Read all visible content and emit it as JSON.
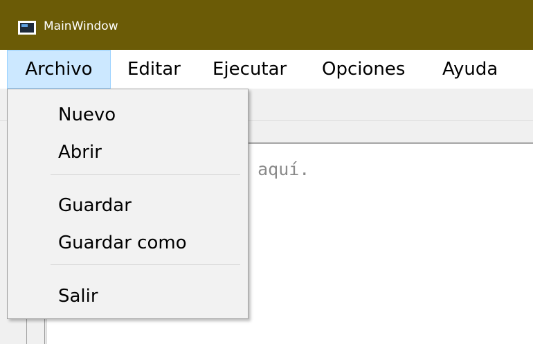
{
  "window": {
    "title": "MainWindow"
  },
  "menubar": {
    "items": [
      {
        "label": "Archivo",
        "active": true
      },
      {
        "label": "Editar"
      },
      {
        "label": "Ejecutar"
      },
      {
        "label": "Opciones"
      },
      {
        "label": "Ayuda"
      }
    ]
  },
  "dropdown": {
    "items": [
      {
        "label": "Nuevo"
      },
      {
        "label": "Abrir"
      },
      {
        "label": "Guardar"
      },
      {
        "label": "Guardar como"
      },
      {
        "label": "Salir"
      }
    ]
  },
  "editor": {
    "visible_text": "s aquí."
  },
  "colors": {
    "titlebar": "#6b5b06",
    "menu_active": "#cce8ff"
  }
}
